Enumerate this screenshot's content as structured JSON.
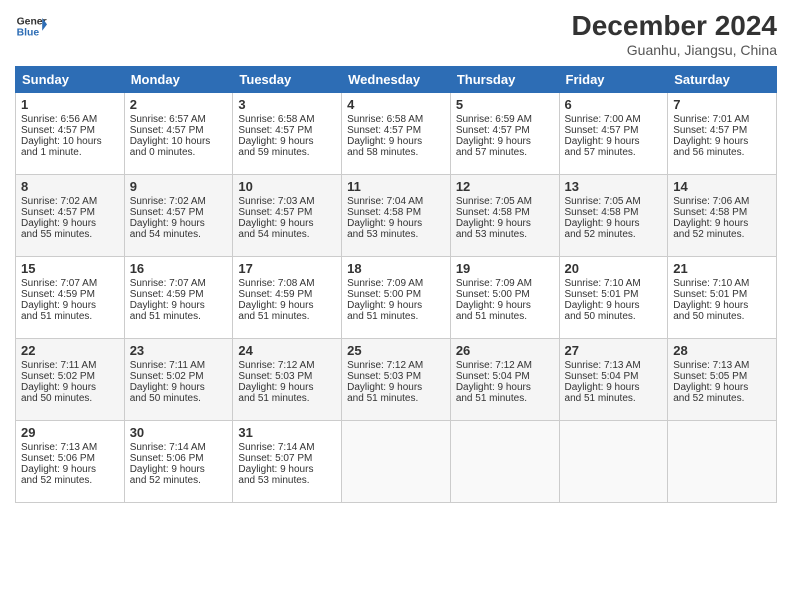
{
  "header": {
    "logo_line1": "General",
    "logo_line2": "Blue",
    "month": "December 2024",
    "location": "Guanhu, Jiangsu, China"
  },
  "days_of_week": [
    "Sunday",
    "Monday",
    "Tuesday",
    "Wednesday",
    "Thursday",
    "Friday",
    "Saturday"
  ],
  "weeks": [
    [
      {
        "day": "1",
        "lines": [
          "Sunrise: 6:56 AM",
          "Sunset: 4:57 PM",
          "Daylight: 10 hours",
          "and 1 minute."
        ]
      },
      {
        "day": "2",
        "lines": [
          "Sunrise: 6:57 AM",
          "Sunset: 4:57 PM",
          "Daylight: 10 hours",
          "and 0 minutes."
        ]
      },
      {
        "day": "3",
        "lines": [
          "Sunrise: 6:58 AM",
          "Sunset: 4:57 PM",
          "Daylight: 9 hours",
          "and 59 minutes."
        ]
      },
      {
        "day": "4",
        "lines": [
          "Sunrise: 6:58 AM",
          "Sunset: 4:57 PM",
          "Daylight: 9 hours",
          "and 58 minutes."
        ]
      },
      {
        "day": "5",
        "lines": [
          "Sunrise: 6:59 AM",
          "Sunset: 4:57 PM",
          "Daylight: 9 hours",
          "and 57 minutes."
        ]
      },
      {
        "day": "6",
        "lines": [
          "Sunrise: 7:00 AM",
          "Sunset: 4:57 PM",
          "Daylight: 9 hours",
          "and 57 minutes."
        ]
      },
      {
        "day": "7",
        "lines": [
          "Sunrise: 7:01 AM",
          "Sunset: 4:57 PM",
          "Daylight: 9 hours",
          "and 56 minutes."
        ]
      }
    ],
    [
      {
        "day": "8",
        "lines": [
          "Sunrise: 7:02 AM",
          "Sunset: 4:57 PM",
          "Daylight: 9 hours",
          "and 55 minutes."
        ]
      },
      {
        "day": "9",
        "lines": [
          "Sunrise: 7:02 AM",
          "Sunset: 4:57 PM",
          "Daylight: 9 hours",
          "and 54 minutes."
        ]
      },
      {
        "day": "10",
        "lines": [
          "Sunrise: 7:03 AM",
          "Sunset: 4:57 PM",
          "Daylight: 9 hours",
          "and 54 minutes."
        ]
      },
      {
        "day": "11",
        "lines": [
          "Sunrise: 7:04 AM",
          "Sunset: 4:58 PM",
          "Daylight: 9 hours",
          "and 53 minutes."
        ]
      },
      {
        "day": "12",
        "lines": [
          "Sunrise: 7:05 AM",
          "Sunset: 4:58 PM",
          "Daylight: 9 hours",
          "and 53 minutes."
        ]
      },
      {
        "day": "13",
        "lines": [
          "Sunrise: 7:05 AM",
          "Sunset: 4:58 PM",
          "Daylight: 9 hours",
          "and 52 minutes."
        ]
      },
      {
        "day": "14",
        "lines": [
          "Sunrise: 7:06 AM",
          "Sunset: 4:58 PM",
          "Daylight: 9 hours",
          "and 52 minutes."
        ]
      }
    ],
    [
      {
        "day": "15",
        "lines": [
          "Sunrise: 7:07 AM",
          "Sunset: 4:59 PM",
          "Daylight: 9 hours",
          "and 51 minutes."
        ]
      },
      {
        "day": "16",
        "lines": [
          "Sunrise: 7:07 AM",
          "Sunset: 4:59 PM",
          "Daylight: 9 hours",
          "and 51 minutes."
        ]
      },
      {
        "day": "17",
        "lines": [
          "Sunrise: 7:08 AM",
          "Sunset: 4:59 PM",
          "Daylight: 9 hours",
          "and 51 minutes."
        ]
      },
      {
        "day": "18",
        "lines": [
          "Sunrise: 7:09 AM",
          "Sunset: 5:00 PM",
          "Daylight: 9 hours",
          "and 51 minutes."
        ]
      },
      {
        "day": "19",
        "lines": [
          "Sunrise: 7:09 AM",
          "Sunset: 5:00 PM",
          "Daylight: 9 hours",
          "and 51 minutes."
        ]
      },
      {
        "day": "20",
        "lines": [
          "Sunrise: 7:10 AM",
          "Sunset: 5:01 PM",
          "Daylight: 9 hours",
          "and 50 minutes."
        ]
      },
      {
        "day": "21",
        "lines": [
          "Sunrise: 7:10 AM",
          "Sunset: 5:01 PM",
          "Daylight: 9 hours",
          "and 50 minutes."
        ]
      }
    ],
    [
      {
        "day": "22",
        "lines": [
          "Sunrise: 7:11 AM",
          "Sunset: 5:02 PM",
          "Daylight: 9 hours",
          "and 50 minutes."
        ]
      },
      {
        "day": "23",
        "lines": [
          "Sunrise: 7:11 AM",
          "Sunset: 5:02 PM",
          "Daylight: 9 hours",
          "and 50 minutes."
        ]
      },
      {
        "day": "24",
        "lines": [
          "Sunrise: 7:12 AM",
          "Sunset: 5:03 PM",
          "Daylight: 9 hours",
          "and 51 minutes."
        ]
      },
      {
        "day": "25",
        "lines": [
          "Sunrise: 7:12 AM",
          "Sunset: 5:03 PM",
          "Daylight: 9 hours",
          "and 51 minutes."
        ]
      },
      {
        "day": "26",
        "lines": [
          "Sunrise: 7:12 AM",
          "Sunset: 5:04 PM",
          "Daylight: 9 hours",
          "and 51 minutes."
        ]
      },
      {
        "day": "27",
        "lines": [
          "Sunrise: 7:13 AM",
          "Sunset: 5:04 PM",
          "Daylight: 9 hours",
          "and 51 minutes."
        ]
      },
      {
        "day": "28",
        "lines": [
          "Sunrise: 7:13 AM",
          "Sunset: 5:05 PM",
          "Daylight: 9 hours",
          "and 52 minutes."
        ]
      }
    ],
    [
      {
        "day": "29",
        "lines": [
          "Sunrise: 7:13 AM",
          "Sunset: 5:06 PM",
          "Daylight: 9 hours",
          "and 52 minutes."
        ]
      },
      {
        "day": "30",
        "lines": [
          "Sunrise: 7:14 AM",
          "Sunset: 5:06 PM",
          "Daylight: 9 hours",
          "and 52 minutes."
        ]
      },
      {
        "day": "31",
        "lines": [
          "Sunrise: 7:14 AM",
          "Sunset: 5:07 PM",
          "Daylight: 9 hours",
          "and 53 minutes."
        ]
      },
      null,
      null,
      null,
      null
    ]
  ]
}
